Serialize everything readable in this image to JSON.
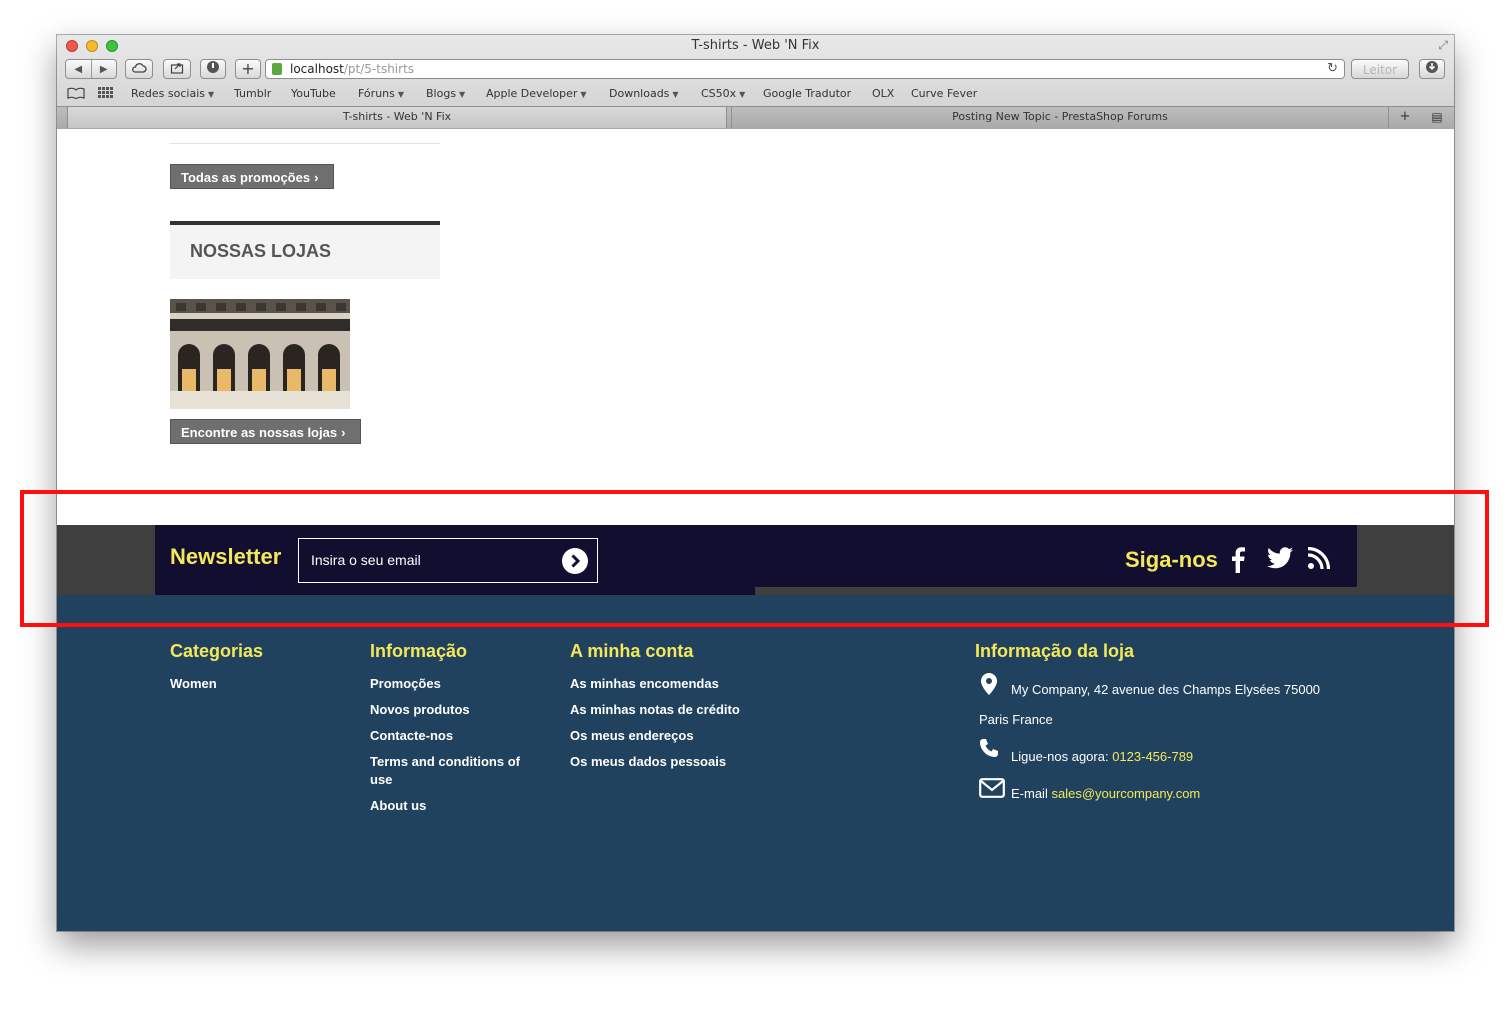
{
  "browser": {
    "window_title": "T-shirts - Web 'N Fix",
    "url_host": "localhost",
    "url_path": "/pt/5-tshirts",
    "reader_label": "Leitor",
    "bookmarks": [
      {
        "label": "Redes sociais",
        "dropdown": true
      },
      {
        "label": "Tumblr",
        "dropdown": false
      },
      {
        "label": "YouTube",
        "dropdown": false
      },
      {
        "label": "Fóruns",
        "dropdown": true
      },
      {
        "label": "Blogs",
        "dropdown": true
      },
      {
        "label": "Apple Developer",
        "dropdown": true
      },
      {
        "label": "Downloads",
        "dropdown": true
      },
      {
        "label": "CS50x",
        "dropdown": true
      },
      {
        "label": "Google Tradutor",
        "dropdown": false
      },
      {
        "label": "OLX",
        "dropdown": false
      },
      {
        "label": "Curve Fever",
        "dropdown": false
      }
    ],
    "tabs": [
      {
        "title": "T-shirts - Web 'N Fix",
        "active": true
      },
      {
        "title": "Posting New Topic - PrestaShop Forums",
        "active": false
      }
    ]
  },
  "sidebar": {
    "promo_button": "Todas as promoções",
    "stores_title": "NOSSAS LOJAS",
    "stores_button": "Encontre as nossas lojas"
  },
  "newsletter": {
    "title": "Newsletter",
    "input_value": "Insira o seu email",
    "follow_title": "Siga-nos",
    "social_icons": [
      "facebook-icon",
      "twitter-icon",
      "rss-icon"
    ]
  },
  "footer": {
    "categories": {
      "title": "Categorias",
      "items": [
        "Women"
      ]
    },
    "information": {
      "title": "Informação",
      "items": [
        "Promoções",
        "Novos produtos",
        "Contacte-nos",
        "Terms and conditions of use",
        "About us"
      ]
    },
    "account": {
      "title": "A minha conta",
      "items": [
        "As minhas encomendas",
        "As minhas notas de crédito",
        "Os meus endereços",
        "Os meus dados pessoais"
      ]
    },
    "store_info": {
      "title": "Informação da loja",
      "address_line1": "My Company, 42 avenue des Champs Elysées 75000",
      "address_line2": "Paris France",
      "phone_label": "Ligue-nos agora:",
      "phone": "0123-456-789",
      "email_label": "E-mail",
      "email": "sales@yourcompany.com"
    }
  },
  "colors": {
    "accent_yellow": "#f3e85a",
    "newsletter_bg": "#120e30",
    "footer_bg": "#21425f",
    "annotation_red": "#ff1010"
  }
}
